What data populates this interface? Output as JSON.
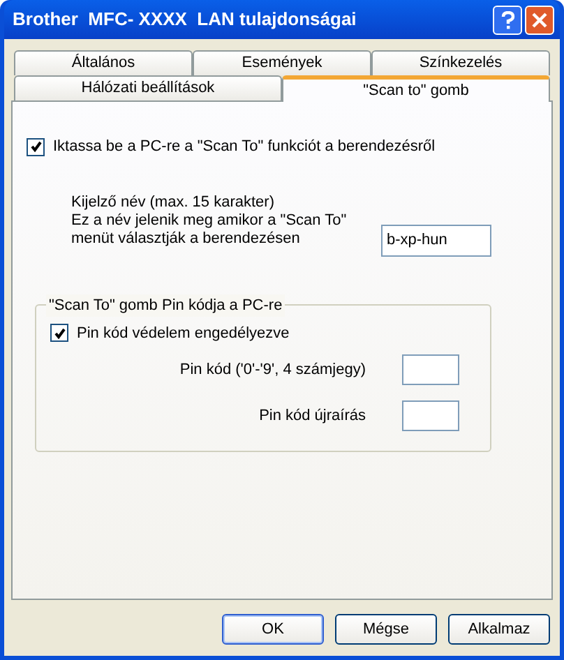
{
  "window": {
    "title": "Brother  MFC- XXXX  LAN tulajdonságai"
  },
  "tab_rows": [
    [
      {
        "label": "Általános",
        "selected": false
      },
      {
        "label": "Események",
        "selected": false
      },
      {
        "label": "Színkezelés",
        "selected": false
      }
    ],
    [
      {
        "label": "Hálózati beállítások",
        "selected": false
      },
      {
        "label": "\"Scan to\" gomb",
        "selected": true
      }
    ]
  ],
  "register_checkbox": {
    "label": "Iktassa be a PC-re a \"Scan To\" funkciót a berendezésről",
    "checked": true
  },
  "display_name": {
    "label_lines": [
      "Kijelző név (max. 15 karakter)",
      "Ez a név jelenik meg amikor a \"Scan To\"",
      "menüt választják a berendezésen"
    ],
    "value": "b-xp-hun"
  },
  "pin_group": {
    "title": "\"Scan To\" gomb Pin kódja a PC-re",
    "checkbox": {
      "label": "Pin kód védelem engedélyezve",
      "checked": true
    },
    "fields": [
      {
        "label": "Pin kód ('0'-'9', 4 számjegy)"
      },
      {
        "label": "Pin kód újraírás"
      }
    ]
  },
  "buttons": [
    {
      "label": "OK",
      "default": true
    },
    {
      "label": "Mégse",
      "default": false
    },
    {
      "label": "Alkalmaz",
      "default": false
    }
  ]
}
